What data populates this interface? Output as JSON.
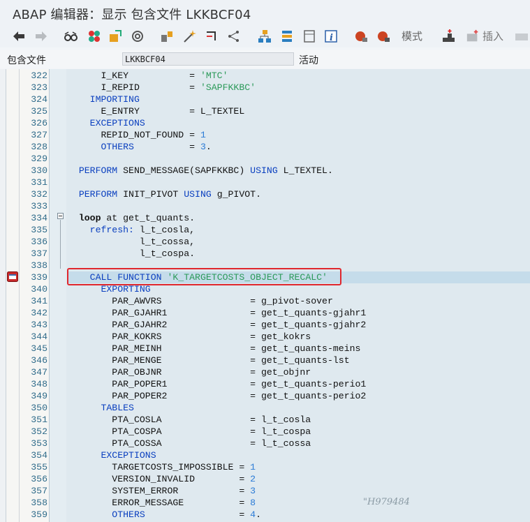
{
  "window": {
    "title": "ABAP 编辑器：显示 包含文件 LKKBCF04"
  },
  "toolbar": {
    "mode_label": "模式",
    "insert_label": "插入",
    "icons": [
      "back-arrow",
      "forward-arrow",
      "glasses",
      "other-object",
      "display-change",
      "activate",
      "where-used",
      "object-list",
      "navigate",
      "hierarchy",
      "stack",
      "frame-page",
      "info",
      "breakpoint-session",
      "breakpoint-external",
      "mode",
      "insert-line",
      "insert"
    ]
  },
  "info": {
    "include_label": "包含文件",
    "include_value": "LKKBCF04",
    "status": "活动"
  },
  "editor": {
    "highlight_line": 339,
    "lines": [
      {
        "n": "322",
        "t": [
          [
            "      I_KEY           = ",
            ""
          ],
          [
            "'MTC'",
            "str"
          ]
        ]
      },
      {
        "n": "323",
        "t": [
          [
            "      I_REPID         = ",
            ""
          ],
          [
            "'SAPFKKBC'",
            "str"
          ]
        ]
      },
      {
        "n": "324",
        "t": [
          [
            "    IMPORTING",
            "kw"
          ]
        ]
      },
      {
        "n": "325",
        "t": [
          [
            "      E_ENTRY         = L_TEXTEL",
            ""
          ]
        ]
      },
      {
        "n": "326",
        "t": [
          [
            "    EXCEPTIONS",
            "kw"
          ]
        ]
      },
      {
        "n": "327",
        "t": [
          [
            "      REPID_NOT_FOUND = ",
            ""
          ],
          [
            "1",
            "lit"
          ]
        ]
      },
      {
        "n": "328",
        "t": [
          [
            "      OTHERS",
            "kw"
          ],
          [
            "          = ",
            ""
          ],
          [
            "3",
            "lit"
          ],
          [
            ".",
            ""
          ]
        ]
      },
      {
        "n": "329",
        "t": []
      },
      {
        "n": "330",
        "t": [
          [
            "  PERFORM",
            "kw"
          ],
          [
            " SEND_MESSAGE(SAPFKKBC) ",
            ""
          ],
          [
            "USING",
            "kw"
          ],
          [
            " L_TEXTEL.",
            ""
          ]
        ]
      },
      {
        "n": "331",
        "t": []
      },
      {
        "n": "332",
        "t": [
          [
            "  PERFORM",
            "kw"
          ],
          [
            " INIT_PIVOT ",
            ""
          ],
          [
            "USING",
            "kw"
          ],
          [
            " g_PIVOT.",
            ""
          ]
        ]
      },
      {
        "n": "333",
        "t": []
      },
      {
        "n": "334",
        "t": [
          [
            "  loop",
            "kwb"
          ],
          [
            " at",
            ""
          ],
          [
            " get_t_quants.",
            ""
          ]
        ]
      },
      {
        "n": "335",
        "t": [
          [
            "    refresh:",
            "kw"
          ],
          [
            " l_t_cosla,",
            ""
          ]
        ]
      },
      {
        "n": "336",
        "t": [
          [
            "             l_t_cossa,",
            ""
          ]
        ]
      },
      {
        "n": "337",
        "t": [
          [
            "             l_t_cospa.",
            ""
          ]
        ]
      },
      {
        "n": "338",
        "t": []
      },
      {
        "n": "339",
        "t": [
          [
            "    CALL FUNCTION",
            "kw"
          ],
          [
            " ",
            ""
          ],
          [
            "'K_TARGETCOSTS_OBJECT_RECALC'",
            "str"
          ]
        ]
      },
      {
        "n": "340",
        "t": [
          [
            "      EXPORTING",
            "kw"
          ]
        ]
      },
      {
        "n": "341",
        "t": [
          [
            "        PAR_AWVRS                = g_pivot-sover",
            ""
          ]
        ]
      },
      {
        "n": "342",
        "t": [
          [
            "        PAR_GJAHR1               = get_t_quants-gjahr1",
            ""
          ]
        ]
      },
      {
        "n": "343",
        "t": [
          [
            "        PAR_GJAHR2               = get_t_quants-gjahr2",
            ""
          ]
        ]
      },
      {
        "n": "344",
        "t": [
          [
            "        PAR_KOKRS                = get_kokrs",
            ""
          ]
        ]
      },
      {
        "n": "345",
        "t": [
          [
            "        PAR_MEINH                = get_t_quants-meins",
            ""
          ]
        ]
      },
      {
        "n": "346",
        "t": [
          [
            "        PAR_MENGE                = get_t_quants-lst",
            ""
          ]
        ]
      },
      {
        "n": "347",
        "t": [
          [
            "        PAR_OBJNR                = get_objnr",
            ""
          ]
        ]
      },
      {
        "n": "348",
        "t": [
          [
            "        PAR_POPER1               = get_t_quants-perio1",
            ""
          ]
        ]
      },
      {
        "n": "349",
        "t": [
          [
            "        PAR_POPER2               = get_t_quants-perio2",
            ""
          ]
        ]
      },
      {
        "n": "350",
        "t": [
          [
            "      TABLES",
            "kw"
          ]
        ]
      },
      {
        "n": "351",
        "t": [
          [
            "        PTA_COSLA                = l_t_cosla",
            ""
          ]
        ]
      },
      {
        "n": "352",
        "t": [
          [
            "        PTA_COSPA                = l_t_cospa",
            ""
          ]
        ]
      },
      {
        "n": "353",
        "t": [
          [
            "        PTA_COSSA                = l_t_cossa",
            ""
          ]
        ]
      },
      {
        "n": "354",
        "t": [
          [
            "      EXCEPTIONS",
            "kw"
          ]
        ]
      },
      {
        "n": "355",
        "t": [
          [
            "        TARGETCOSTS_IMPOSSIBLE = ",
            ""
          ],
          [
            "1",
            "lit"
          ]
        ]
      },
      {
        "n": "356",
        "t": [
          [
            "        VERSION_INVALID        = ",
            ""
          ],
          [
            "2",
            "lit"
          ]
        ]
      },
      {
        "n": "357",
        "t": [
          [
            "        SYSTEM_ERROR           = ",
            ""
          ],
          [
            "3",
            "lit"
          ]
        ]
      },
      {
        "n": "358",
        "t": [
          [
            "        ERROR_MESSAGE          = ",
            ""
          ],
          [
            "8",
            "lit"
          ]
        ]
      },
      {
        "n": "359",
        "t": [
          [
            "        OTHERS",
            "kw"
          ],
          [
            "                 = ",
            ""
          ],
          [
            "4",
            "lit"
          ],
          [
            ".",
            ""
          ]
        ]
      }
    ]
  },
  "watermark": "\"H979484"
}
